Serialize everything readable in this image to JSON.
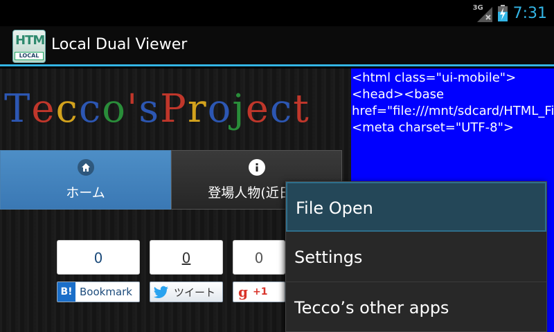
{
  "status": {
    "network": "3G",
    "time": "7:31"
  },
  "actionbar": {
    "icon_text_top": "HTMI",
    "icon_text_bottom": "LOCAL",
    "title": "Local Dual Viewer"
  },
  "web": {
    "banner_title": "Tecco's Project",
    "tabs": [
      {
        "label": "ホーム",
        "icon": "home-icon",
        "active": true
      },
      {
        "label": "登場人物(近日公",
        "icon": "info-icon",
        "active": false
      }
    ],
    "social": {
      "hatena": {
        "count": "0",
        "label": "Bookmark",
        "mark": "B!"
      },
      "twitter": {
        "count": "0",
        "label": "ツイート"
      },
      "gplus": {
        "count": "0",
        "label": "+1",
        "mark": "g"
      }
    }
  },
  "source": {
    "text": "<html class=\"ui-mobile\"><head><base href=\"file:///mnt/sdcard/HTML_File/detectiveDroidSeriesTop_s.html\">\n<meta charset=\"UTF-8\">"
  },
  "menu": {
    "items": [
      {
        "label": "File Open"
      },
      {
        "label": "Settings"
      },
      {
        "label": "Tecco’s other apps"
      }
    ]
  },
  "colors": {
    "accent": "#33b5e5",
    "source_bg": "#0000ff",
    "tab_active": "#4283bf"
  }
}
